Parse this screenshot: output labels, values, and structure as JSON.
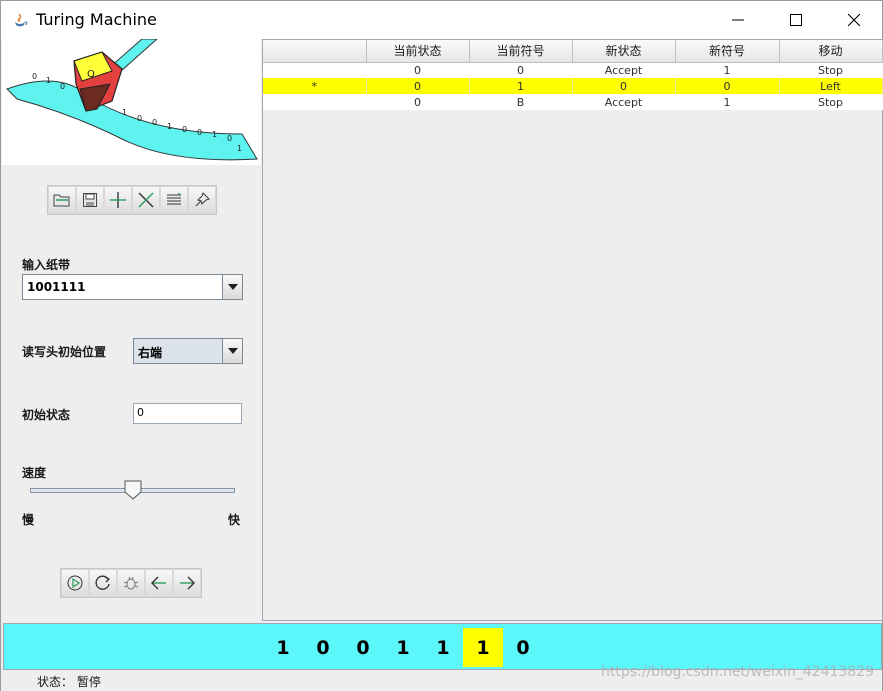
{
  "window": {
    "title": "Turing Machine"
  },
  "toolbar_top": {
    "icons": [
      "open-icon",
      "save-icon",
      "add-icon",
      "delete-icon",
      "list-icon",
      "pin-icon"
    ]
  },
  "tape_input": {
    "label": "输入纸带",
    "value": "1001111"
  },
  "head_position": {
    "label": "读写头初始位置",
    "value": "右端"
  },
  "initial_state": {
    "label": "初始状态",
    "value": "0"
  },
  "speed": {
    "label": "速度",
    "slow": "慢",
    "fast": "快",
    "level": 0.5
  },
  "toolbar_bottom": {
    "icons": [
      "play-icon",
      "reset-icon",
      "debug-icon",
      "left-arrow-icon",
      "right-arrow-icon"
    ]
  },
  "table": {
    "columns": [
      "",
      "当前状态",
      "当前符号",
      "新状态",
      "新符号",
      "移动"
    ],
    "rows": [
      [
        "",
        "0",
        "0",
        "Accept",
        "1",
        "Stop"
      ],
      [
        "*",
        "0",
        "1",
        "0",
        "0",
        "Left"
      ],
      [
        "",
        "0",
        "B",
        "Accept",
        "1",
        "Stop"
      ]
    ],
    "selected_row": 1
  },
  "tape": {
    "cells": [
      "1",
      "0",
      "0",
      "1",
      "1",
      "1",
      "0"
    ],
    "head_index": 5
  },
  "status": {
    "text": "状态： 暂停"
  },
  "watermark": "https://blog.csdn.net/weixin_42413829",
  "colors": {
    "tape_bg": "#5cf7fb",
    "highlight": "#ffff00"
  }
}
